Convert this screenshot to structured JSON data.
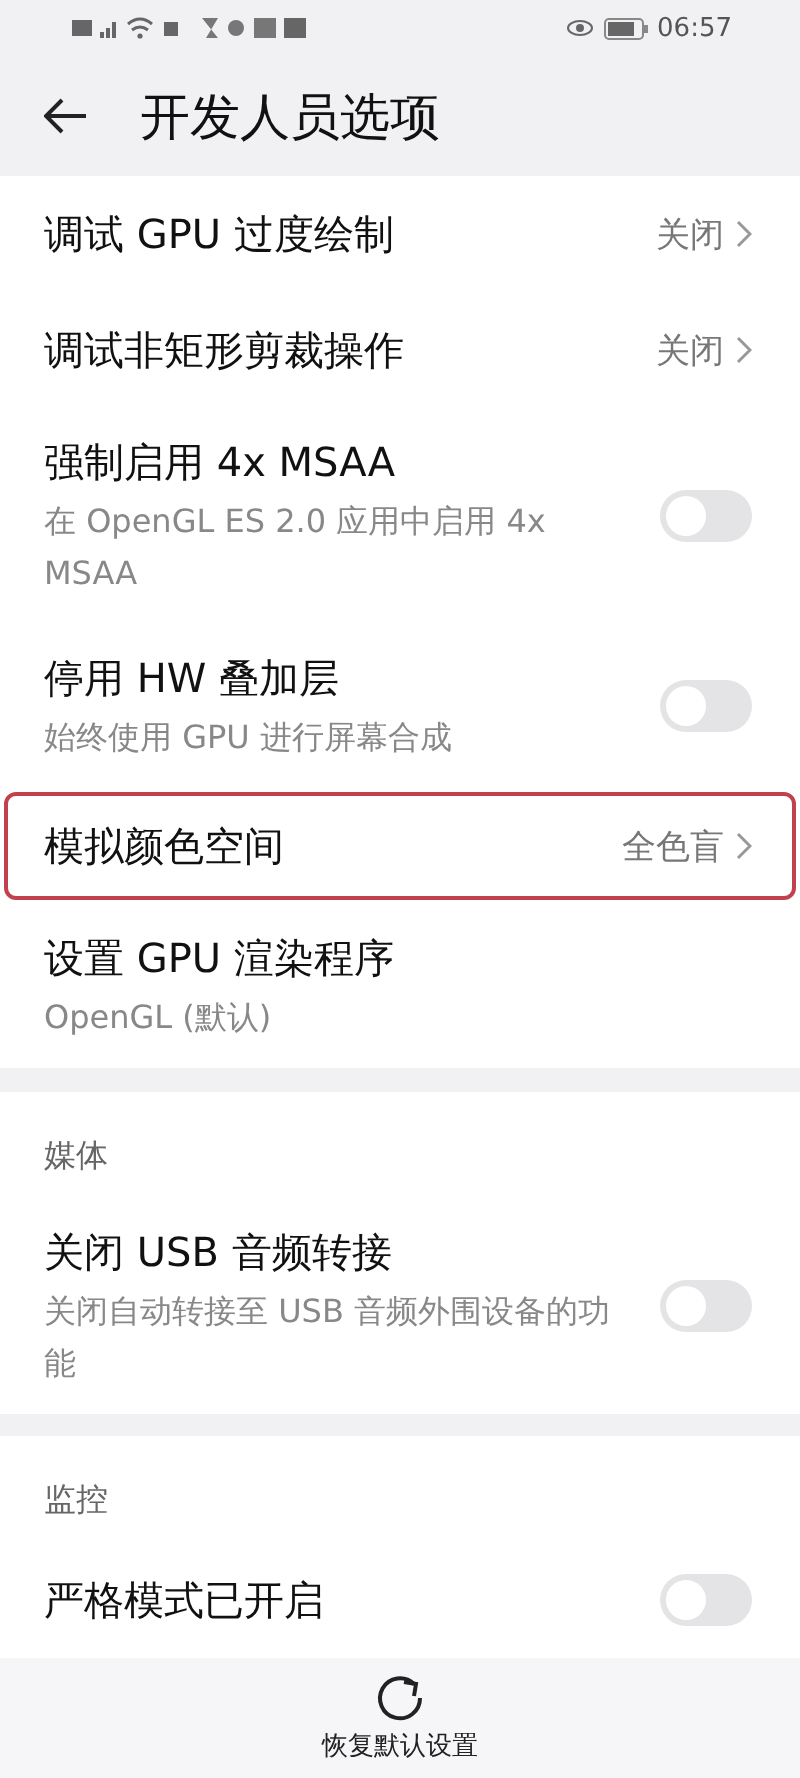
{
  "status_bar": {
    "time": "06:57"
  },
  "header": {
    "title": "开发人员选项"
  },
  "sections": [
    {
      "items": [
        {
          "kind": "link",
          "title": "调试 GPU 过度绘制",
          "value": "关闭",
          "highlighted": false
        },
        {
          "kind": "link",
          "title": "调试非矩形剪裁操作",
          "value": "关闭",
          "highlighted": false
        },
        {
          "kind": "toggle",
          "title": "强制启用 4x MSAA",
          "subtitle": "在 OpenGL ES 2.0 应用中启用 4x MSAA",
          "on": false
        },
        {
          "kind": "toggle",
          "title": "停用 HW 叠加层",
          "subtitle": "始终使用 GPU 进行屏幕合成",
          "on": false
        },
        {
          "kind": "link",
          "title": "模拟颜色空间",
          "value": "全色盲",
          "highlighted": true
        },
        {
          "kind": "info",
          "title": "设置 GPU 渲染程序",
          "subtitle": "OpenGL (默认)"
        }
      ]
    },
    {
      "header": "媒体",
      "items": [
        {
          "kind": "toggle",
          "title": "关闭 USB 音频转接",
          "subtitle": "关闭自动转接至 USB 音频外围设备的功能",
          "on": false
        }
      ]
    },
    {
      "header": "监控",
      "items": [
        {
          "kind": "toggle",
          "title": "严格模式已开启",
          "on": false
        }
      ]
    }
  ],
  "bottom_button": {
    "label": "恢复默认设置"
  }
}
